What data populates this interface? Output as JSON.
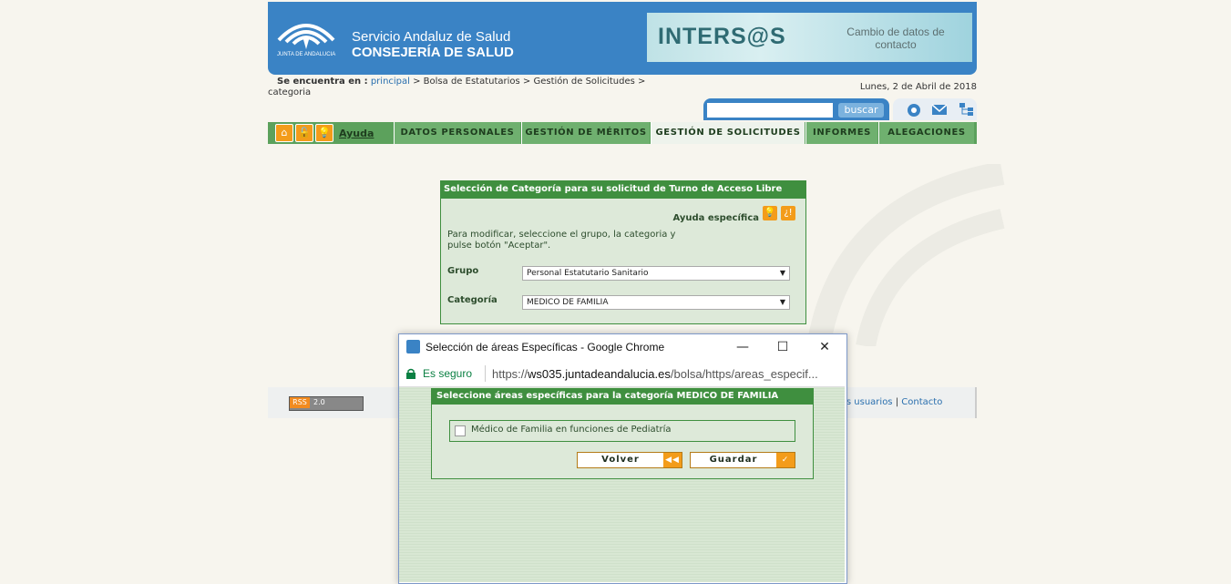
{
  "header": {
    "org_line1": "Servicio Andaluz de Salud",
    "org_line2": "CONSEJERÍA DE SALUD",
    "logo_sub": "JUNTA DE ANDALUCIA",
    "banner_title": "INTERS@S",
    "banner_sub": "Cambio de datos de contacto"
  },
  "breadcrumb": {
    "label": "Se encuentra en :",
    "home": "principal",
    "path": " > Bolsa de Estatutarios > Gestión de Solicitudes > categoria"
  },
  "date": "Lunes, 2 de Abril de 2018",
  "search": {
    "value": "",
    "button": "buscar"
  },
  "nav": {
    "help": "Ayuda",
    "items": [
      "DATOS PERSONALES",
      "GESTIÓN DE MÉRITOS",
      "GESTIÓN DE SOLICITUDES",
      "INFORMES",
      "ALEGACIONES"
    ]
  },
  "category_panel": {
    "title": "Selección de Categoría para su solicitud de Turno de Acceso Libre",
    "help": "Ayuda específica",
    "instructions": "Para modificar, seleccione el grupo, la categoria y pulse botón \"Aceptar\".",
    "group_label": "Grupo",
    "group_value": "Personal Estatutario Sanitario",
    "category_label": "Categoría",
    "category_value": "MEDICO DE FAMILIA"
  },
  "footer": {
    "rss_left": "RSS",
    "rss_right": "2.0",
    "links_text": "los usuarios",
    "contact": "Contacto"
  },
  "popup": {
    "window_title": "Selección de áreas Específicas - Google Chrome",
    "secure_label": "Es seguro",
    "url_scheme": "https://",
    "url_host": "ws035.juntadeandalucia.es",
    "url_path": "/bolsa/https/areas_especif...",
    "panel_title": "Seleccione áreas específicas para la categoría MEDICO DE FAMILIA",
    "area_option": "Médico de Familia en funciones de Pediatría",
    "back_button": "Volver",
    "save_button": "Guardar"
  }
}
